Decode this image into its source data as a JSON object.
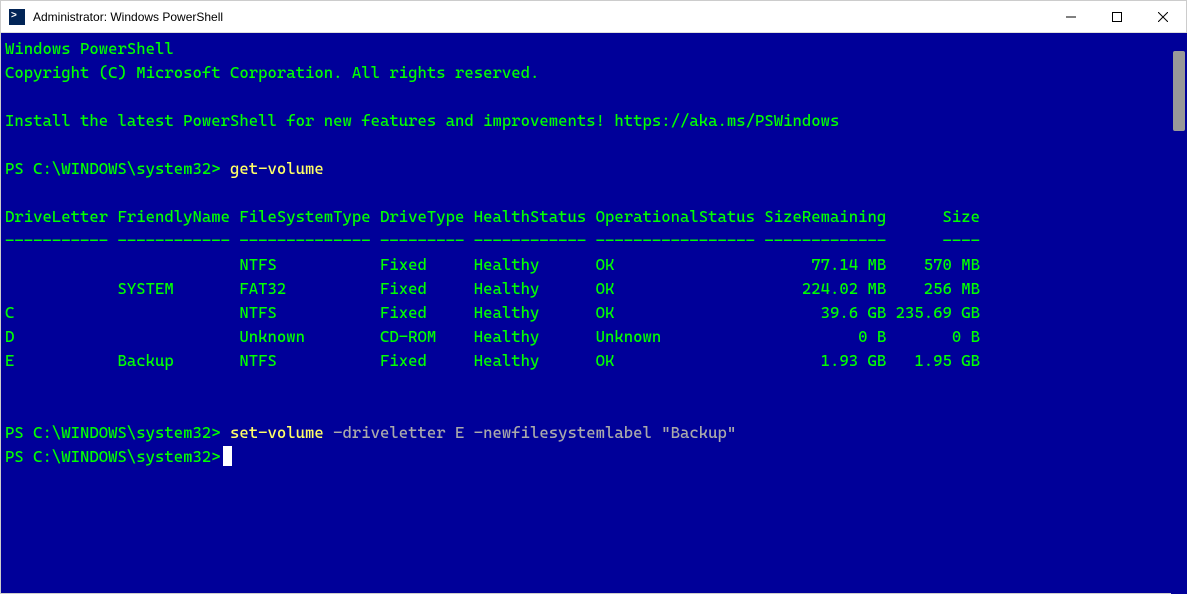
{
  "window": {
    "title": "Administrator: Windows PowerShell"
  },
  "banner": {
    "line1": "Windows PowerShell",
    "line2": "Copyright (C) Microsoft Corporation. All rights reserved.",
    "line3": "Install the latest PowerShell for new features and improvements! https://aka.ms/PSWindows"
  },
  "prompt": "PS C:\\WINDOWS\\system32>",
  "commands": {
    "cmd1": "get-volume",
    "cmd2_cmdlet": "set-volume",
    "cmd2_rest": " -driveletter E -newfilesystemlabel \"Backup\""
  },
  "table": {
    "headers": {
      "h1": "DriveLetter",
      "h2": "FriendlyName",
      "h3": "FileSystemType",
      "h4": "DriveType",
      "h5": "HealthStatus",
      "h6": "OperationalStatus",
      "h7": "SizeRemaining",
      "h8": "Size"
    },
    "separator": "----------- ------------ -------------- --------- ------------ ----------------- -------------      ----",
    "rows": [
      {
        "dl": "",
        "fn": "",
        "fs": "NTFS",
        "dt": "Fixed",
        "hs": "Healthy",
        "os": "OK",
        "sr": "77.14 MB",
        "sz": "570 MB"
      },
      {
        "dl": "",
        "fn": "SYSTEM",
        "fs": "FAT32",
        "dt": "Fixed",
        "hs": "Healthy",
        "os": "OK",
        "sr": "224.02 MB",
        "sz": "256 MB"
      },
      {
        "dl": "C",
        "fn": "",
        "fs": "NTFS",
        "dt": "Fixed",
        "hs": "Healthy",
        "os": "OK",
        "sr": "39.6 GB",
        "sz": "235.69 GB"
      },
      {
        "dl": "D",
        "fn": "",
        "fs": "Unknown",
        "dt": "CD-ROM",
        "hs": "Healthy",
        "os": "Unknown",
        "sr": "0 B",
        "sz": "0 B"
      },
      {
        "dl": "E",
        "fn": "Backup",
        "fs": "NTFS",
        "dt": "Fixed",
        "hs": "Healthy",
        "os": "OK",
        "sr": "1.93 GB",
        "sz": "1.95 GB"
      }
    ]
  }
}
